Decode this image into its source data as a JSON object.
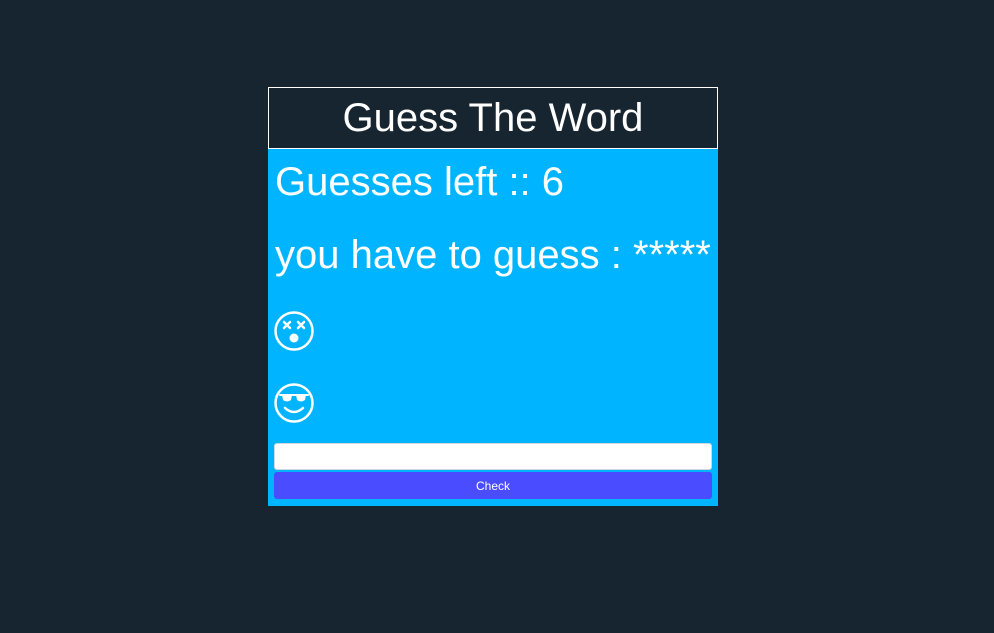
{
  "app": {
    "title": "Guess The Word"
  },
  "status": {
    "guesses_label": "Guesses left :: ",
    "guesses_left": "6",
    "target_label": "you have to guess : ",
    "masked_word": "*****"
  },
  "faces": [
    {
      "icon": "dizzy-face-icon"
    },
    {
      "icon": "sunglasses-face-icon"
    }
  ],
  "form": {
    "input_value": "",
    "input_placeholder": "",
    "check_label": "Check"
  },
  "colors": {
    "background": "#172530",
    "panel": "#00b4ff",
    "button": "#4a4dff",
    "text": "#ffffff"
  }
}
